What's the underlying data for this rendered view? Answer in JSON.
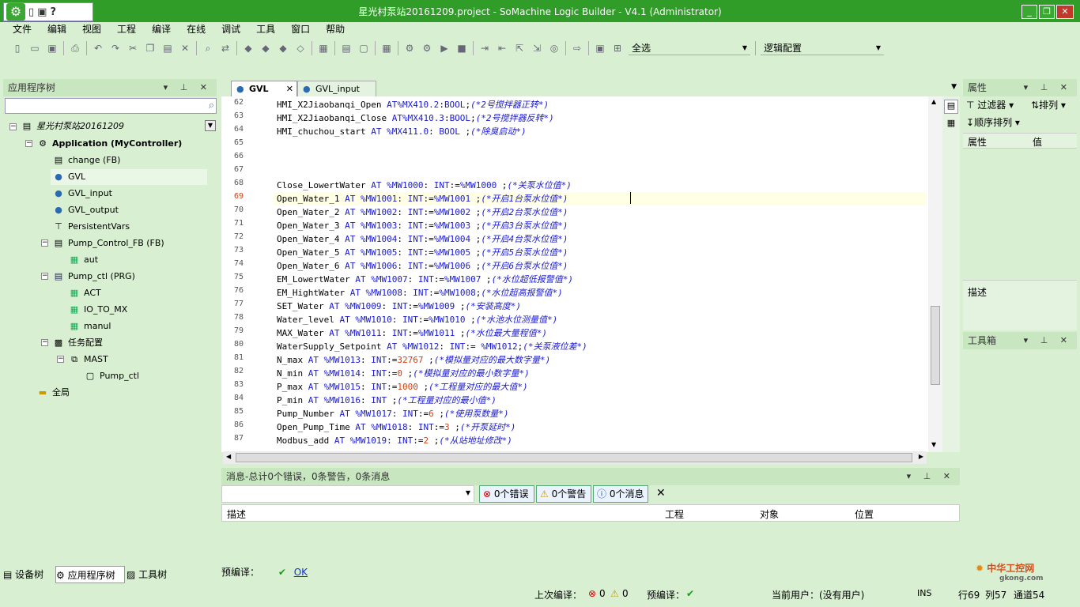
{
  "window": {
    "title": "星光村泵站20161209.project - SoMachine Logic Builder - V4.1 (Administrator)",
    "minimize": "_",
    "restore": "❐",
    "close": "✕"
  },
  "menu": [
    "文件",
    "编辑",
    "视图",
    "工程",
    "编译",
    "在线",
    "调试",
    "工具",
    "窗口",
    "帮助"
  ],
  "toolbar": {
    "select_combo": "全选",
    "config_combo": "逻辑配置"
  },
  "left_panel": {
    "title": "应用程序树",
    "tree": {
      "root": "星光村泵站20161209",
      "application": "Application (MyController)",
      "items": [
        {
          "label": "change (FB)",
          "icon": "document-icon"
        },
        {
          "label": "GVL",
          "icon": "globe-icon"
        },
        {
          "label": "GVL_input",
          "icon": "globe-icon"
        },
        {
          "label": "GVL_output",
          "icon": "globe-icon"
        },
        {
          "label": "PersistentVars",
          "icon": "persistent-icon"
        },
        {
          "label": "Pump_Control_FB (FB)",
          "icon": "document-icon"
        },
        {
          "label": "aut",
          "icon": "action-icon"
        },
        {
          "label": "Pump_ctl (PRG)",
          "icon": "program-icon"
        },
        {
          "label": "ACT",
          "icon": "action-icon"
        },
        {
          "label": "IO_TO_MX",
          "icon": "action-icon"
        },
        {
          "label": "manul",
          "icon": "action-icon"
        },
        {
          "label": "任务配置",
          "icon": "task-config-icon"
        },
        {
          "label": "MAST",
          "icon": "task-icon"
        },
        {
          "label": "Pump_ctl",
          "icon": "call-icon"
        },
        {
          "label": "全局",
          "icon": "folder-icon"
        }
      ]
    },
    "bottom_tabs": [
      "设备树",
      "应用程序树",
      "工具树"
    ]
  },
  "editor": {
    "tabs": [
      "GVL",
      "GVL_input"
    ],
    "lines": [
      {
        "n": "62",
        "text": "HMI_X2Jiaobanqi_Open AT%MX410.2:BOOL;(*2号搅拌器正转*)"
      },
      {
        "n": "63",
        "text": "HMI_X2Jiaobanqi_Close AT%MX410.3:BOOL;(*2号搅拌器反转*)"
      },
      {
        "n": "64",
        "text": "HMI_chuchou_start AT %MX411.0: BOOL ;(*除臭启动*)"
      },
      {
        "n": "65",
        "text": ""
      },
      {
        "n": "66",
        "text": ""
      },
      {
        "n": "67",
        "text": ""
      },
      {
        "n": "68",
        "text": "Close_LowertWater AT %MW1000: INT:=%MW1000 ;(*关泵水位值*)"
      },
      {
        "n": "69",
        "text": "Open_Water_1 AT %MW1001: INT:=%MW1001 ;(*开启1台泵水位值*)"
      },
      {
        "n": "70",
        "text": "Open_Water_2 AT %MW1002: INT:=%MW1002 ;(*开启2台泵水位值*)"
      },
      {
        "n": "71",
        "text": "Open_Water_3 AT %MW1003: INT:=%MW1003 ;(*开启3台泵水位值*)"
      },
      {
        "n": "72",
        "text": "Open_Water_4 AT %MW1004: INT:=%MW1004 ;(*开启4台泵水位值*)"
      },
      {
        "n": "73",
        "text": "Open_Water_5 AT %MW1005: INT:=%MW1005 ;(*开启5台泵水位值*)"
      },
      {
        "n": "74",
        "text": "Open_Water_6 AT %MW1006: INT:=%MW1006 ;(*开启6台泵水位值*)"
      },
      {
        "n": "75",
        "text": "EM_LowertWater AT %MW1007: INT:=%MW1007 ;(*水位超低报警值*)"
      },
      {
        "n": "76",
        "text": "EM_HightWater AT %MW1008: INT:=%MW1008;(*水位超高报警值*)"
      },
      {
        "n": "77",
        "text": "SET_Water AT %MW1009: INT:=%MW1009 ;(*安装高度*)"
      },
      {
        "n": "78",
        "text": "Water_level AT %MW1010: INT:=%MW1010 ;(*水池水位测量值*)"
      },
      {
        "n": "79",
        "text": "MAX_Water AT %MW1011: INT:=%MW1011 ;(*水位最大量程值*)"
      },
      {
        "n": "80",
        "text": "WaterSupply_Setpoint AT %MW1012: INT:= %MW1012;(*关泵液位差*)"
      },
      {
        "n": "81",
        "text": "N_max AT %MW1013: INT:=32767 ;(*模拟量对应的最大数字量*)"
      },
      {
        "n": "82",
        "text": "N_min AT %MW1014: INT:=0 ;(*模拟量对应的最小数字量*)"
      },
      {
        "n": "83",
        "text": "P_max AT %MW1015: INT:=1000 ;(*工程量对应的最大值*)"
      },
      {
        "n": "84",
        "text": "P_min AT %MW1016: INT ;(*工程量对应的最小值*)"
      },
      {
        "n": "85",
        "text": "Pump_Number AT %MW1017: INT:=6 ;(*使用泵数量*)"
      },
      {
        "n": "86",
        "text": "Open_Pump_Time AT %MW1018: INT:=3 ;(*开泵延时*)"
      },
      {
        "n": "87",
        "text": "Modbus_add AT %MW1019: INT:=2 ;(*从站地址修改*)"
      }
    ]
  },
  "properties_panel": {
    "title": "属性",
    "filter_label": "过滤器",
    "sort_label": "排列",
    "order_label": "顺序排列",
    "col_attr": "属性",
    "col_value": "值",
    "desc_label": "描述"
  },
  "toolbox_panel": {
    "title": "工具箱"
  },
  "messages_panel": {
    "title": "消息-总计0个错误，0条警告，0条消息",
    "errors": "0个错误",
    "warnings": "0个警告",
    "messages": "0个消息",
    "columns": [
      "描述",
      "工程",
      "对象",
      "位置"
    ],
    "precompile_label": "预编译：",
    "precompile_status": "OK"
  },
  "statusbar": {
    "last_compile": "上次编译：",
    "err_count": "0",
    "warn_count": "0",
    "precompile": "预编译：",
    "current_user": "当前用户：(没有用户)",
    "ins": "INS",
    "row": "行69",
    "col": "列57",
    "channel": "通道54"
  },
  "watermark": {
    "text": "中华工控网",
    "sub": "gkong.com"
  }
}
